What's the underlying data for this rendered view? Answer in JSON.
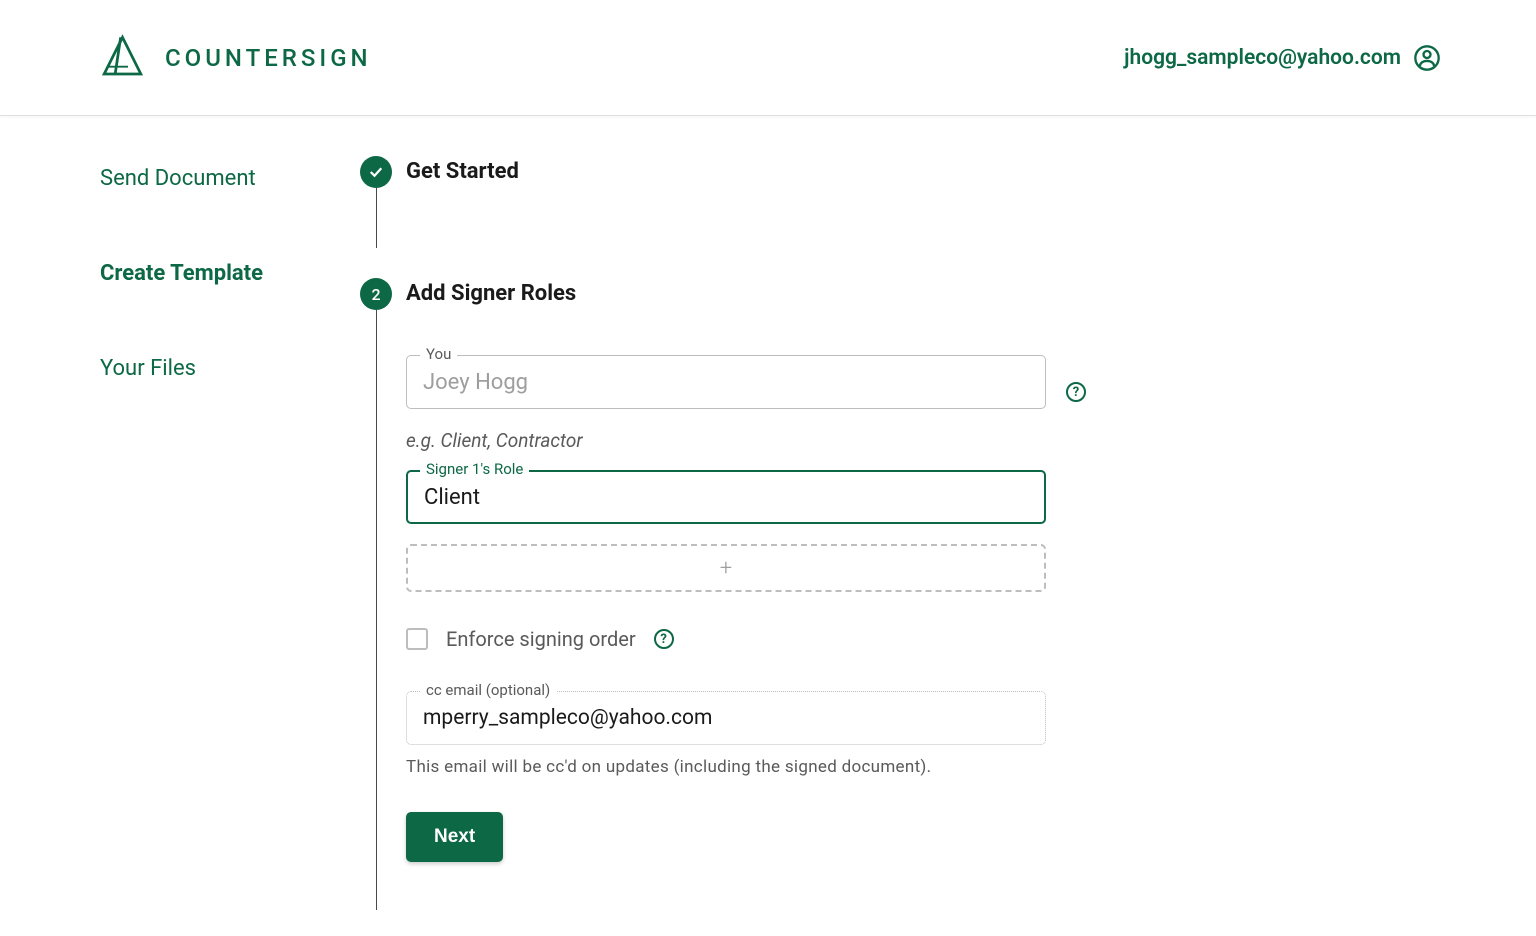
{
  "header": {
    "logo_text": "COUNTERSIGN",
    "user_email": "jhogg_sampleco@yahoo.com"
  },
  "sidebar": {
    "items": [
      {
        "label": "Send Document"
      },
      {
        "label": "Create Template"
      },
      {
        "label": "Your Files"
      }
    ]
  },
  "wizard": {
    "steps": [
      {
        "title": "Get Started",
        "completed": true
      },
      {
        "title": "Add Signer Roles",
        "number": "2"
      }
    ],
    "you_field": {
      "label": "You",
      "value": "Joey Hogg"
    },
    "role_hint": "e.g. Client, Contractor",
    "signer_field": {
      "label": "Signer 1's Role",
      "value": "Client"
    },
    "enforce_label": "Enforce signing order",
    "cc_field": {
      "label": "cc email (optional)",
      "value": "mperry_sampleco@yahoo.com"
    },
    "cc_hint": "This email will be cc'd on updates (including the signed document).",
    "next_label": "Next"
  }
}
